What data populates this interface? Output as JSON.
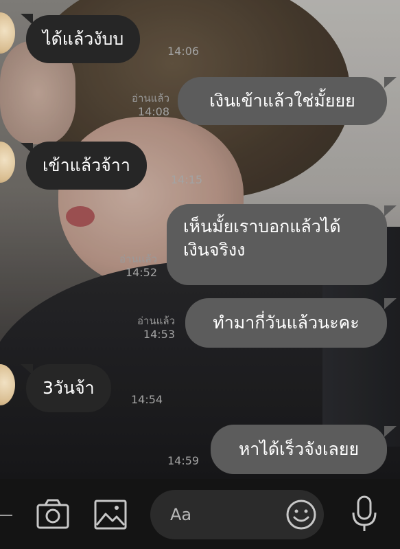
{
  "messages": [
    {
      "direction": "incoming",
      "text": "ได้แล้วงับบ",
      "time": "14:06"
    },
    {
      "direction": "outgoing",
      "text": "เงินเข้าแล้วใช่มั้ยยย",
      "read": "อ่านแล้ว",
      "time": "14:08"
    },
    {
      "direction": "incoming",
      "text": "เข้าแล้วจ้าา",
      "time": "14:15"
    },
    {
      "direction": "outgoing",
      "line1": "เห็นมั้ยเราบอกแล้วได้",
      "line2": "เงินจริงง",
      "read": "อ่านแล้ว",
      "time": "14:52"
    },
    {
      "direction": "outgoing",
      "text": "ทำมากี่วันแล้วนะคะ",
      "read": "อ่านแล้ว",
      "time": "14:53"
    },
    {
      "direction": "incoming",
      "text": "3วันจ้า",
      "time": "14:54"
    },
    {
      "direction": "outgoing",
      "text": "หาได้เร็วจังเลยย",
      "time": "14:59"
    }
  ],
  "input_bar": {
    "placeholder": "Aa",
    "icons": [
      "camera-icon",
      "image-icon",
      "emoji-icon",
      "microphone-icon"
    ]
  },
  "colors": {
    "incoming_bubble": "#262626",
    "outgoing_bubble": "#5c5c5c",
    "input_bar_bg": "#141414",
    "text_field_bg": "#2b2b2b"
  }
}
